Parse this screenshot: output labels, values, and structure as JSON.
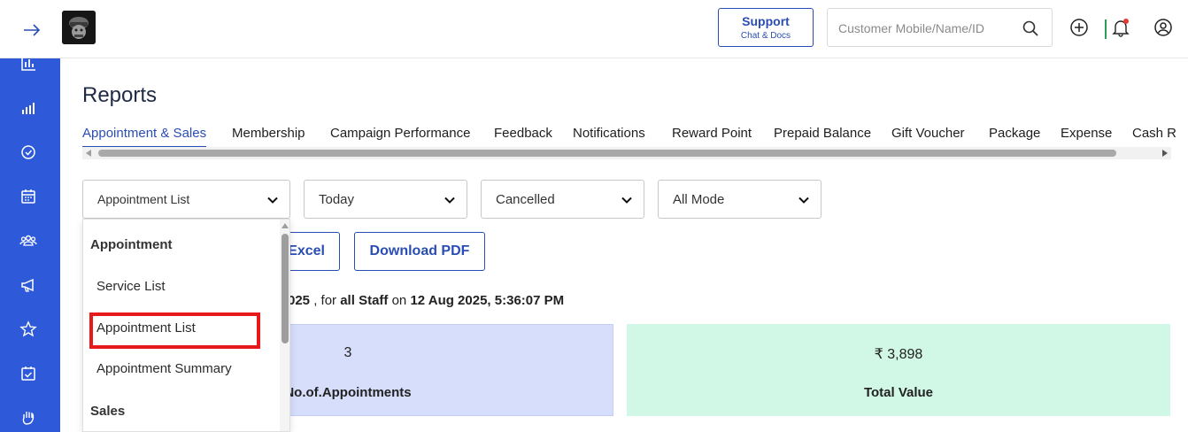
{
  "header": {
    "support_label": "Support",
    "support_sub": "Chat & Docs",
    "search_placeholder": "Customer Mobile/Name/ID",
    "icons": [
      "arrow-right-icon",
      "plus-circle-icon",
      "bell-icon",
      "user-icon",
      "search-icon"
    ]
  },
  "sidebar": {
    "icons": [
      "bar-chart-icon",
      "signal-bars-icon",
      "check-circle-icon",
      "calendar-icon",
      "users-icon",
      "megaphone-icon",
      "star-icon",
      "calendar-check-icon",
      "hand-icon"
    ]
  },
  "page": {
    "title": "Reports"
  },
  "tabs": [
    {
      "label": "Appointment & Sales",
      "active": true
    },
    {
      "label": "Membership"
    },
    {
      "label": "Campaign Performance"
    },
    {
      "label": "Feedback"
    },
    {
      "label": "Notifications"
    },
    {
      "label": "Reward Point"
    },
    {
      "label": "Prepaid Balance"
    },
    {
      "label": "Gift Voucher"
    },
    {
      "label": "Package"
    },
    {
      "label": "Expense"
    },
    {
      "label": "Cash R"
    }
  ],
  "filters": {
    "report_type": "Appointment List",
    "period": "Today",
    "status": "Cancelled",
    "mode": "All Mode"
  },
  "buttons": {
    "excel": "Excel",
    "pdf": "Download PDF"
  },
  "info": {
    "date_fragment": "025",
    "for_text": ", for",
    "staff": "all Staff",
    "on_text": "on",
    "timestamp": "12 Aug 2025, 5:36:07 PM"
  },
  "cards": {
    "appointments_value": "3",
    "appointments_label": "No.of.Appointments",
    "total_value": "₹ 3,898",
    "total_label": "Total Value"
  },
  "dropdown": {
    "group1": "Appointment",
    "items1": [
      "Service List",
      "Appointment List",
      "Appointment Summary"
    ],
    "group2": "Sales"
  },
  "colors": {
    "sidebar": "#2e59d9",
    "accent": "#2a4db5",
    "card_blue": "#d6defb",
    "card_green": "#d1f7e6",
    "highlight": "#e8191b"
  }
}
